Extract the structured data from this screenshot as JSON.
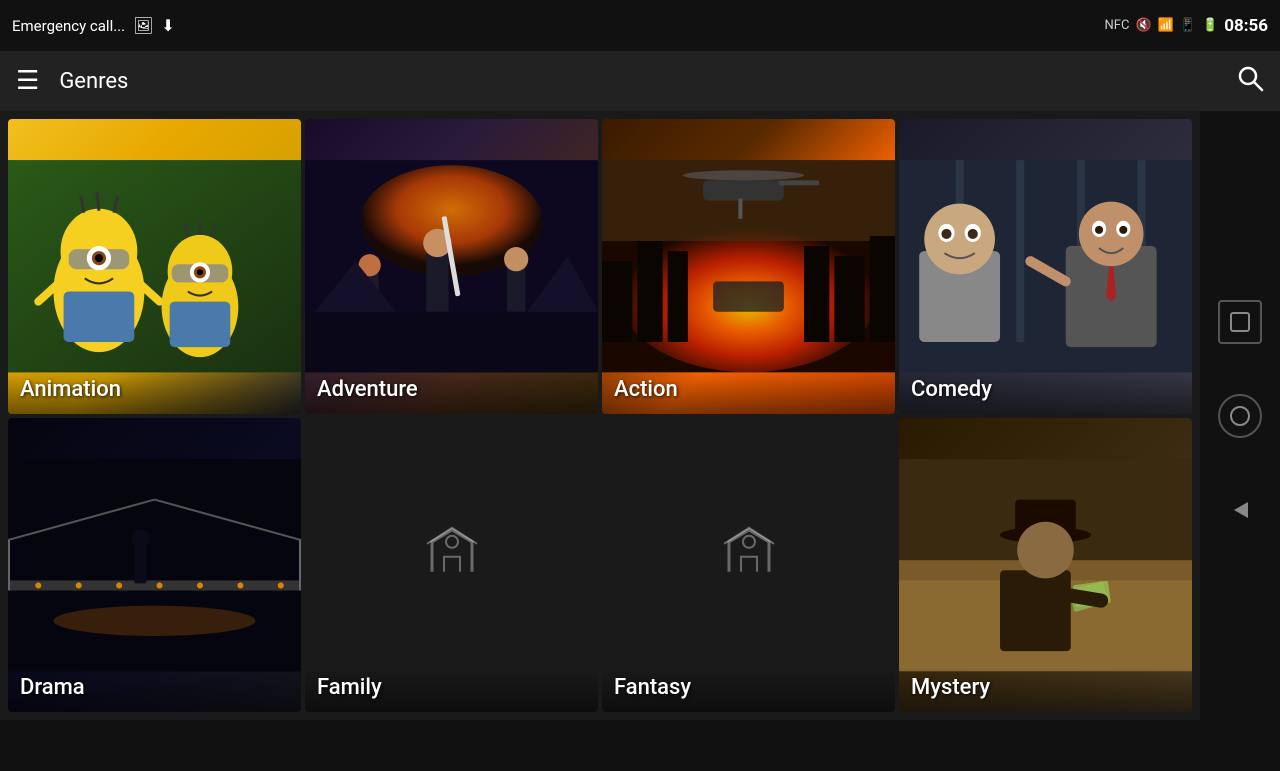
{
  "statusBar": {
    "leftText": "Emergency call...",
    "time": "08:56",
    "icons": [
      "nfc",
      "mute",
      "wifi",
      "sim",
      "battery"
    ]
  },
  "topBar": {
    "title": "Genres",
    "hamburgerLabel": "☰",
    "searchLabel": "🔍"
  },
  "genres": {
    "row1": [
      {
        "id": "animation",
        "label": "Animation",
        "cardClass": "card-animation"
      },
      {
        "id": "adventure",
        "label": "Adventure",
        "cardClass": "card-adventure"
      },
      {
        "id": "action",
        "label": "Action",
        "cardClass": "card-action"
      },
      {
        "id": "comedy",
        "label": "Comedy",
        "cardClass": "card-comedy"
      }
    ],
    "row2": [
      {
        "id": "drama",
        "label": "Drama",
        "cardClass": "card-drama"
      },
      {
        "id": "family",
        "label": "Family",
        "cardClass": "card-family"
      },
      {
        "id": "fantasy",
        "label": "Fantasy",
        "cardClass": "card-fantasy"
      },
      {
        "id": "mystery",
        "label": "Mystery",
        "cardClass": "card-mystery"
      }
    ]
  },
  "navButtons": {
    "square": "⬜",
    "circle": "○",
    "back": "◁"
  }
}
